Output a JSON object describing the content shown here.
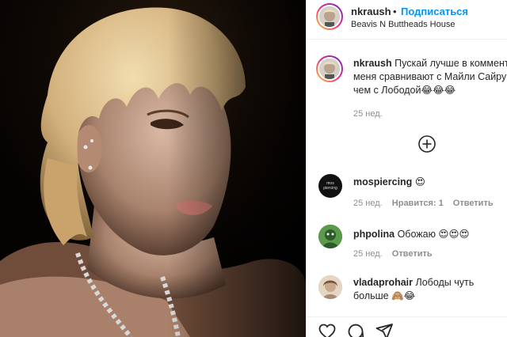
{
  "post": {
    "author": "nkraush",
    "separator": "•",
    "follow_label": "Подписаться",
    "location": "Beavis N Buttheads House"
  },
  "caption": {
    "author": "nkraush",
    "line1": "Пускай лучше в коммент",
    "line2": "меня сравнивают с Майли Сайру",
    "line3": "чем с Лободой😂😂😂",
    "time": "25 нед."
  },
  "load_more_icon": "plus-circle-icon",
  "comments": [
    {
      "author": "mospiercing",
      "text": "😍",
      "avatar_text": "mos piercing",
      "time": "25 нед.",
      "likes": "Нравится: 1",
      "reply": "Ответить"
    },
    {
      "author": "phpolina",
      "text": "Обожаю 😍😍😍",
      "time": "25 нед.",
      "reply": "Ответить"
    },
    {
      "author": "vladaprohair",
      "text": "Лободы чуть",
      "text2": "больше 🙈😂"
    }
  ],
  "actions": {
    "like_icon": "heart-icon",
    "comment_icon": "comment-icon",
    "share_icon": "paper-plane-icon"
  },
  "colors": {
    "follow": "#0095f6",
    "meta": "#8e8e8e",
    "text": "#262626",
    "border": "#efefef"
  }
}
